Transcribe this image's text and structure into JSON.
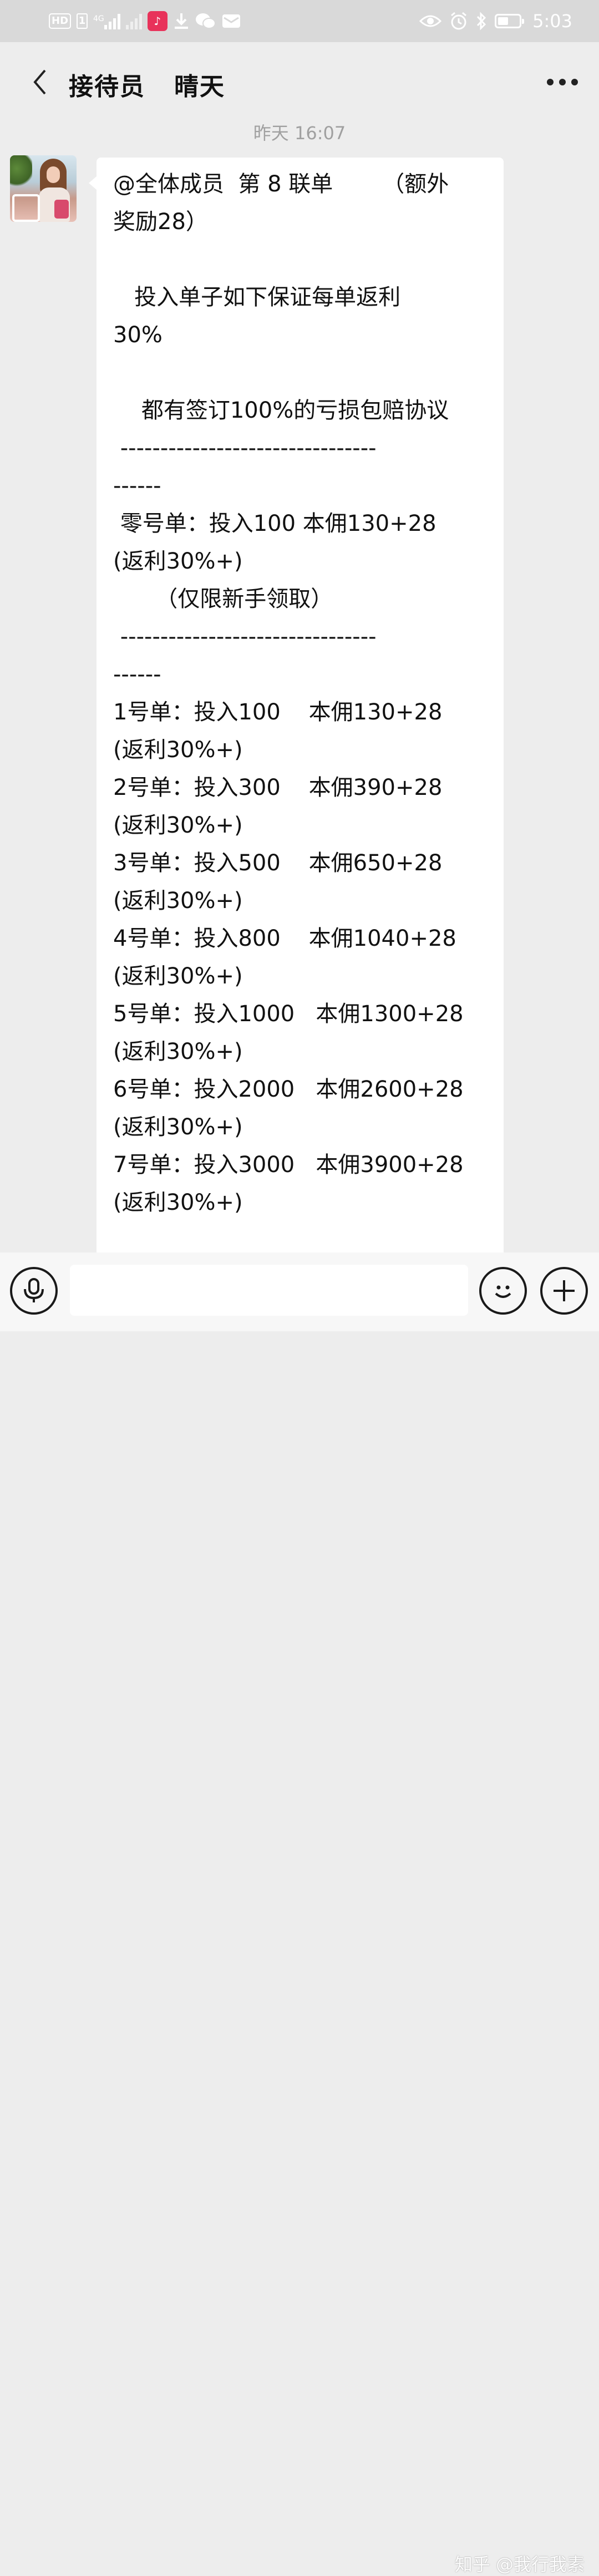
{
  "status_bar": {
    "hd_label": "HD",
    "sim_label": "1",
    "network_label": "4G",
    "time": "5:03",
    "battery_level": 0.5,
    "icons": [
      "hd-icon",
      "sim-icon",
      "signal-icon",
      "no-signal-icon",
      "tiktok-icon",
      "download-icon",
      "wechat-icon",
      "mail-icon",
      "eye-icon",
      "alarm-icon",
      "bluetooth-icon",
      "battery-icon"
    ]
  },
  "header": {
    "title": "接待员   晴天",
    "back_icon": "chevron-left-icon",
    "more_icon": "more-dots-icon"
  },
  "chat": {
    "timestamp": "昨天 16:07",
    "message_lines": [
      "@全体成员  第 8 联单       （额外",
      "奖励28）",
      "",
      "   投入单子如下保证每单返利",
      "30%",
      "",
      "    都有签订100%的亏损包赔协议",
      " --------------------------------",
      "------",
      " 零号单：投入100 本佣130+28",
      "(返利30%+)",
      "      （仅限新手领取）",
      " --------------------------------",
      "------",
      "1号单：投入100    本佣130+28",
      "(返利30%+)",
      "2号单：投入300    本佣390+28",
      "(返利30%+)",
      "3号单：投入500    本佣650+28",
      "(返利30%+)",
      "4号单：投入800    本佣1040+28",
      "(返利30%+)",
      "5号单：投入1000   本佣1300+28",
      "(返利30%+)",
      "6号单：投入2000   本佣2600+28",
      "(返利30%+)",
      "7号单：投入3000   本佣3900+28",
      "(返利30%+)"
    ]
  },
  "input_bar": {
    "voice_icon": "microphone-icon",
    "emoji_icon": "smiley-icon",
    "plus_icon": "plus-icon"
  },
  "watermark": "知乎 @我行我素",
  "colors": {
    "background": "#ededed",
    "bubble": "#ffffff",
    "status_bar": "#d9d9d9",
    "timestamp": "#a0a0a0"
  }
}
